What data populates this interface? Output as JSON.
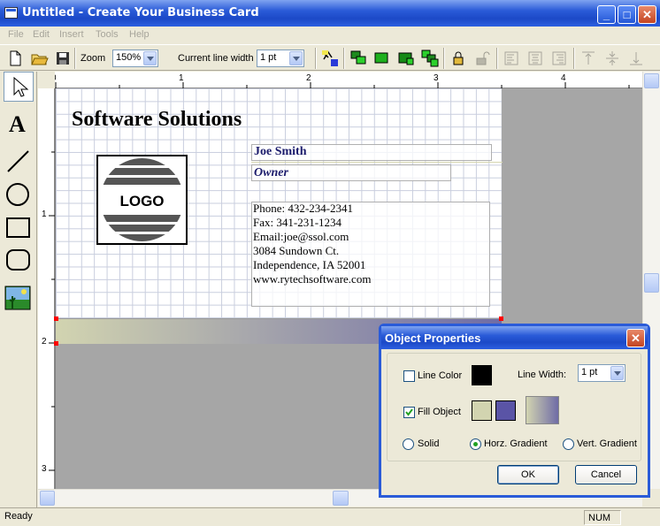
{
  "window": {
    "title": "Untitled - Create Your Business Card"
  },
  "menu": [
    "File",
    "Edit",
    "Insert",
    "Tools",
    "Help"
  ],
  "toolbar": {
    "zoom_label": "Zoom",
    "zoom_value": "150%",
    "line_width_label": "Current line width",
    "line_width_value": "1 pt"
  },
  "ruler": {
    "h": [
      "0",
      "1",
      "2",
      "3",
      "4"
    ],
    "v": [
      "1",
      "2",
      "3"
    ]
  },
  "card": {
    "company": "Software Solutions",
    "name": "Joe Smith",
    "role": "Owner",
    "logo": "LOGO",
    "contact": [
      "Phone: 432-234-2341",
      "Fax: 341-231-1234",
      "Email:joe@ssol.com",
      "3084 Sundown Ct.",
      "Independence, IA 52001",
      "www.rytechsoftware.com"
    ],
    "gradient_colors": [
      "#d2d4b0",
      "#6f6ca6"
    ]
  },
  "dialog": {
    "title": "Object Properties",
    "line_color_label": "Line Color",
    "line_color_checked": false,
    "line_color": "#000000",
    "line_width_label": "Line Width:",
    "line_width_value": "1 pt",
    "fill_label": "Fill Object",
    "fill_checked": true,
    "fill_color_1": "#d2d4b0",
    "fill_color_2": "#5a54a6",
    "fill_options": [
      "Solid",
      "Horz. Gradient",
      "Vert. Gradient"
    ],
    "fill_selected": "Horz. Gradient",
    "ok_label": "OK",
    "cancel_label": "Cancel"
  },
  "status": {
    "text": "Ready",
    "num": "NUM"
  }
}
